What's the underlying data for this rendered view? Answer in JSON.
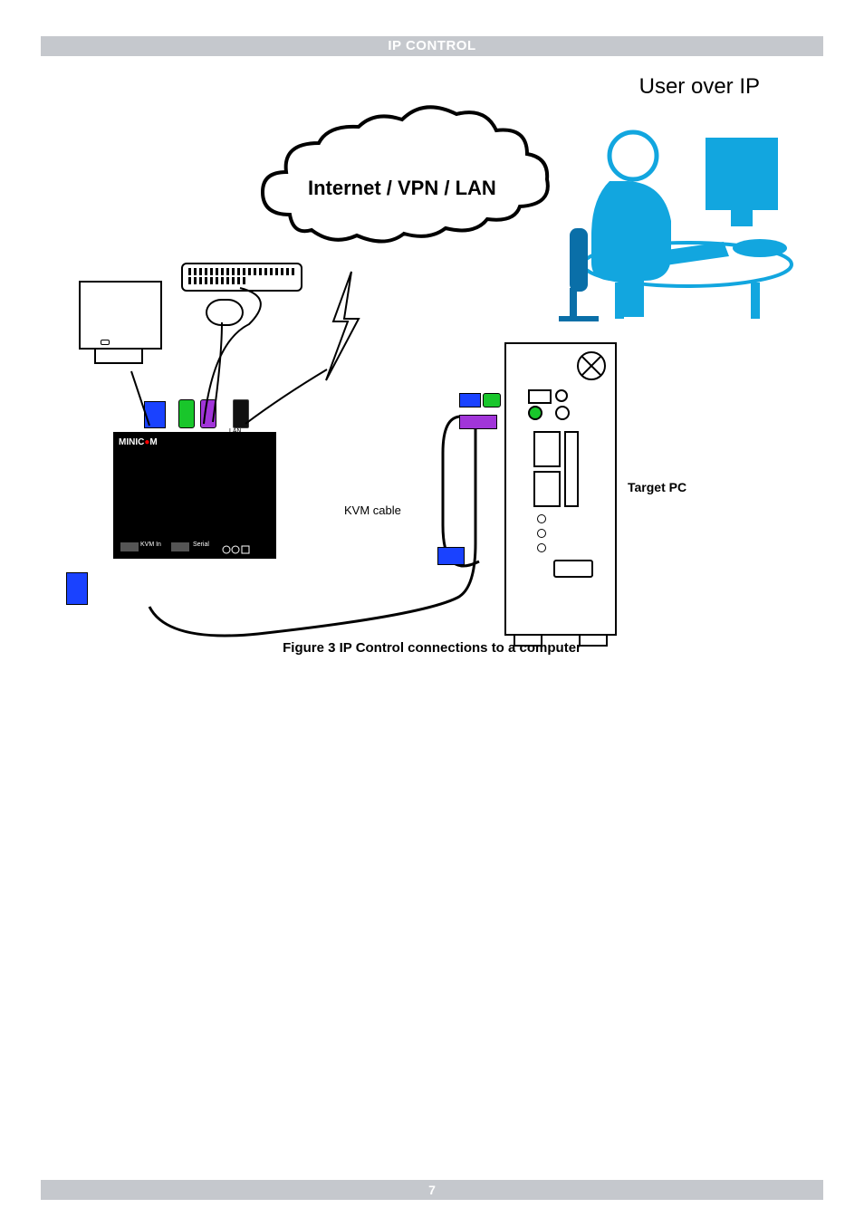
{
  "header": {
    "title": "IP CONTROL"
  },
  "diagram": {
    "user_over_ip_label": "User over IP",
    "cloud_label": "Internet / VPN / LAN",
    "kvm_cable_label": "KVM cable",
    "target_pc_label": "Target PC",
    "device_brand_left": "MINIC",
    "device_brand_right": "M",
    "port_labels": {
      "lan": "LAN",
      "kvm_in": "KVM In",
      "serial": "Serial"
    },
    "caption": "Figure 3 IP Control connections to a computer"
  },
  "footer": {
    "page_number": "7"
  }
}
